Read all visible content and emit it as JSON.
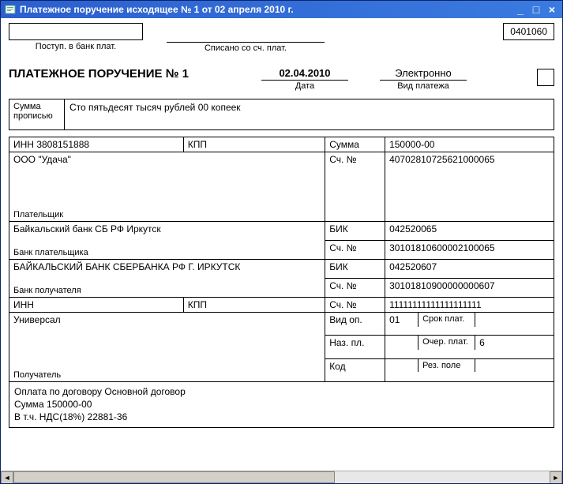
{
  "window": {
    "title": "Платежное поручение исходящее № 1 от 02 апреля 2010 г."
  },
  "top": {
    "bank_in_label": "Поступ. в банк плат.",
    "written_off_label": "Списано со сч. плат.",
    "code": "0401060"
  },
  "header": {
    "title": "ПЛАТЕЖНОЕ ПОРУЧЕНИЕ № 1",
    "date_value": "02.04.2010",
    "date_label": "Дата",
    "paytype_value": "Электронно",
    "paytype_label": "Вид платежа"
  },
  "amount_words": {
    "label": "Сумма\nпрописью",
    "value": "Сто пятьдесят тысяч рублей 00 копеек"
  },
  "payer": {
    "inn_label": "ИНН",
    "inn": "3808151888",
    "kpp_label": "КПП",
    "kpp": "",
    "name": "ООО \"Удача\"",
    "block_label": "Плательщик",
    "amount_label": "Сумма",
    "amount": "150000-00",
    "acct_label": "Сч. №",
    "acct": "40702810725621000065"
  },
  "payer_bank": {
    "name": "Байкальский банк СБ РФ Иркутск",
    "block_label": "Банк плательщика",
    "bik_label": "БИК",
    "bik": "042520065",
    "acct_label": "Сч. №",
    "acct": "30101810600002100065"
  },
  "rcpt_bank": {
    "name": "БАЙКАЛЬСКИЙ БАНК СБЕРБАНКА РФ Г. ИРКУТСК",
    "block_label": "Банк получателя",
    "bik_label": "БИК",
    "bik": "042520607",
    "acct_label": "Сч. №",
    "acct": "30101810900000000607"
  },
  "rcpt": {
    "inn_label": "ИНН",
    "inn": "",
    "kpp_label": "КПП",
    "kpp": "",
    "name": "Универсал",
    "block_label": "Получатель",
    "acct_label": "Сч. №",
    "acct": "11111111111111111111"
  },
  "flags": {
    "vidop_label": "Вид оп.",
    "vidop": "01",
    "srok_label": "Срок плат.",
    "srok": "",
    "nazpl_label": "Наз. пл.",
    "nazpl": "",
    "ocher_label": "Очер. плат.",
    "ocher": "6",
    "kod_label": "Код",
    "kod": "",
    "rez_label": "Рез. поле",
    "rez": ""
  },
  "purpose": {
    "line1": "Оплата по договору Основной договор",
    "line2": "Сумма 150000-00",
    "line3": "В т.ч. НДС(18%) 22881-36"
  }
}
